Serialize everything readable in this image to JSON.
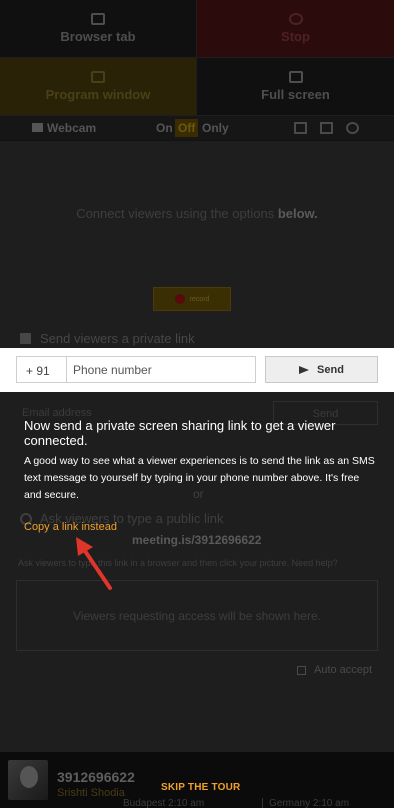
{
  "tiles": {
    "browser_tab": "Browser tab",
    "stop": "Stop",
    "program_window": "Program window",
    "full_screen": "Full screen"
  },
  "webcam": {
    "label": "Webcam",
    "on": "On",
    "off": "Off",
    "only": "Only"
  },
  "connect": {
    "text": "Connect viewers using the options",
    "emphasis": "below."
  },
  "record_label": "record",
  "private_link_label": "Send viewers a private link",
  "phone": {
    "country_code": "+ 91",
    "placeholder": "Phone number",
    "value": "",
    "send_label": "Send"
  },
  "email": {
    "placeholder": "Email address",
    "send_label": "Send"
  },
  "or_label": "or",
  "public_link_label": "Ask viewers to type a public link",
  "meeting_link": "meeting.is/3912696622",
  "ask_text": "Ask viewers to type this link in a browser and then click your picture. Need help?",
  "requests_placeholder": "Viewers requesting access will be shown here.",
  "auto_accept_label": "Auto accept",
  "tour": {
    "title": "Now send a private screen sharing link to get a viewer connected.",
    "body": "A good way to see what a viewer experiences is to send the link as an SMS text message to yourself by typing in your phone number above. It's free and secure.",
    "copy_link": "Copy a link instead",
    "skip": "SKIP THE TOUR"
  },
  "user": {
    "number": "3912696622",
    "name": "Srishti Shodia"
  },
  "clocks": {
    "first": "Budapest 2:10 am",
    "second": "Germany 2:10 am"
  },
  "colors": {
    "accent": "#f0a229",
    "overlay": "#1e1e1e"
  }
}
